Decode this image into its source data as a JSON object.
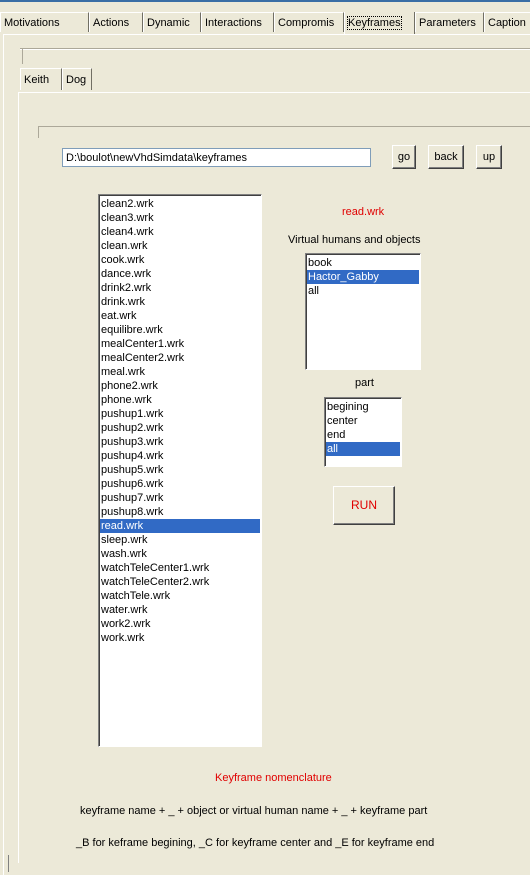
{
  "tabs": [
    "Motivations",
    "Actions",
    "Dynamic",
    "Interactions",
    "Compromis",
    "Keyframes",
    "Parameters",
    "Caption"
  ],
  "active_tab": "Keyframes",
  "subtabs": [
    "Keith",
    "Dog"
  ],
  "path": "D:\\boulot\\newVhdSimdata\\keyframes",
  "buttons": {
    "go": "go",
    "back": "back",
    "up": "up",
    "run": "RUN"
  },
  "files": [
    "clean2.wrk",
    "clean3.wrk",
    "clean4.wrk",
    "clean.wrk",
    "cook.wrk",
    "dance.wrk",
    "drink2.wrk",
    "drink.wrk",
    "eat.wrk",
    "equilibre.wrk",
    "mealCenter1.wrk",
    "mealCenter2.wrk",
    "meal.wrk",
    "phone2.wrk",
    "phone.wrk",
    "pushup1.wrk",
    "pushup2.wrk",
    "pushup3.wrk",
    "pushup4.wrk",
    "pushup5.wrk",
    "pushup6.wrk",
    "pushup7.wrk",
    "pushup8.wrk",
    "read.wrk",
    "sleep.wrk",
    "wash.wrk",
    "watchTeleCenter1.wrk",
    "watchTeleCenter2.wrk",
    "watchTele.wrk",
    "water.wrk",
    "work2.wrk",
    "work.wrk"
  ],
  "selected_file": "read.wrk",
  "selected_file_label": "read.wrk",
  "humans_label": "Virtual humans and objects",
  "humans": [
    "book",
    "Hactor_Gabby",
    "all"
  ],
  "selected_human": "Hactor_Gabby",
  "part_label": "part",
  "parts": [
    "begining",
    "center",
    "end",
    "all"
  ],
  "selected_part": "all",
  "nomenclature_title": "Keyframe nomenclature",
  "nomenclature_line1": "keyframe name + _ + object or virtual human name + _ + keyframe part",
  "nomenclature_line2": "_B for keframe begining, _C for keyframe center and _E for keyframe end",
  "colors": {
    "accent": "#e00000",
    "selection": "#316ac5",
    "panel": "#ece9d8"
  }
}
